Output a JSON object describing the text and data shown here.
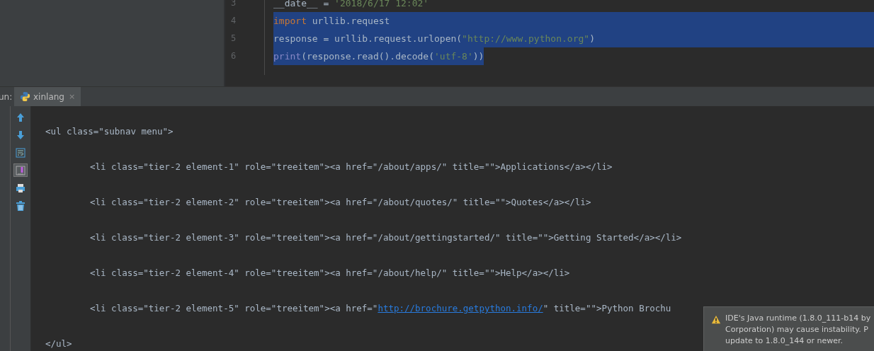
{
  "editor": {
    "lines": [
      {
        "number": "3",
        "selected": false,
        "tokens": [
          {
            "kind": "plain",
            "text": "__date__ = "
          },
          {
            "kind": "string",
            "text": "'2018/6/17 12:02'"
          }
        ]
      },
      {
        "number": "4",
        "selected": true,
        "tokens": [
          {
            "kind": "keyword",
            "text": "import"
          },
          {
            "kind": "plain",
            "text": " urllib.request"
          }
        ]
      },
      {
        "number": "5",
        "selected": true,
        "tokens": [
          {
            "kind": "plain",
            "text": "response = urllib.request.urlopen("
          },
          {
            "kind": "string",
            "text": "\"http://www.python.org\""
          },
          {
            "kind": "plain",
            "text": ")"
          }
        ]
      },
      {
        "number": "6",
        "selected": true,
        "tokens": [
          {
            "kind": "builtin",
            "text": "print"
          },
          {
            "kind": "plain",
            "text": "(response.read().decode("
          },
          {
            "kind": "string",
            "text": "'utf-8'"
          },
          {
            "kind": "plain",
            "text": "))"
          }
        ]
      }
    ]
  },
  "run_panel": {
    "label": "un:",
    "tabs": [
      {
        "title": "xinlang",
        "close": "×",
        "selected": true
      }
    ],
    "tools": [
      {
        "kind": "up",
        "selected": false
      },
      {
        "kind": "down",
        "selected": false
      },
      {
        "kind": "wrap",
        "selected": false
      },
      {
        "kind": "scroll",
        "selected": true
      },
      {
        "kind": "print",
        "selected": false
      },
      {
        "kind": "trash",
        "selected": false
      }
    ],
    "console": [
      {
        "segments": [
          {
            "link": false,
            "text": "<ul class=\"subnav menu\">"
          }
        ],
        "children": [
          {
            "segments": [
              {
                "link": false,
                "text": "<li class=\"tier-2 element-1\" role=\"treeitem\"><a href=\"/about/apps/\" title=\"\">Applications</a></li>"
              }
            ]
          },
          {
            "segments": [
              {
                "link": false,
                "text": "<li class=\"tier-2 element-2\" role=\"treeitem\"><a href=\"/about/quotes/\" title=\"\">Quotes</a></li>"
              }
            ]
          },
          {
            "segments": [
              {
                "link": false,
                "text": "<li class=\"tier-2 element-3\" role=\"treeitem\"><a href=\"/about/gettingstarted/\" title=\"\">Getting Started</a></li>"
              }
            ]
          },
          {
            "segments": [
              {
                "link": false,
                "text": "<li class=\"tier-2 element-4\" role=\"treeitem\"><a href=\"/about/help/\" title=\"\">Help</a></li>"
              }
            ]
          },
          {
            "segments": [
              {
                "link": false,
                "text": "<li class=\"tier-2 element-5\" role=\"treeitem\"><a href=\""
              },
              {
                "link": true,
                "text": "http://brochure.getpython.info/"
              },
              {
                "link": false,
                "text": "\" title=\"\">Python Brochu"
              }
            ]
          }
        ]
      },
      {
        "segments": [
          {
            "link": false,
            "text": "</ul>"
          }
        ]
      }
    ]
  },
  "notification": {
    "lines": [
      "IDE's Java runtime (1.8.0_111-b14 by",
      "Corporation) may cause instability. P",
      "update to 1.8.0_144 or newer."
    ]
  }
}
